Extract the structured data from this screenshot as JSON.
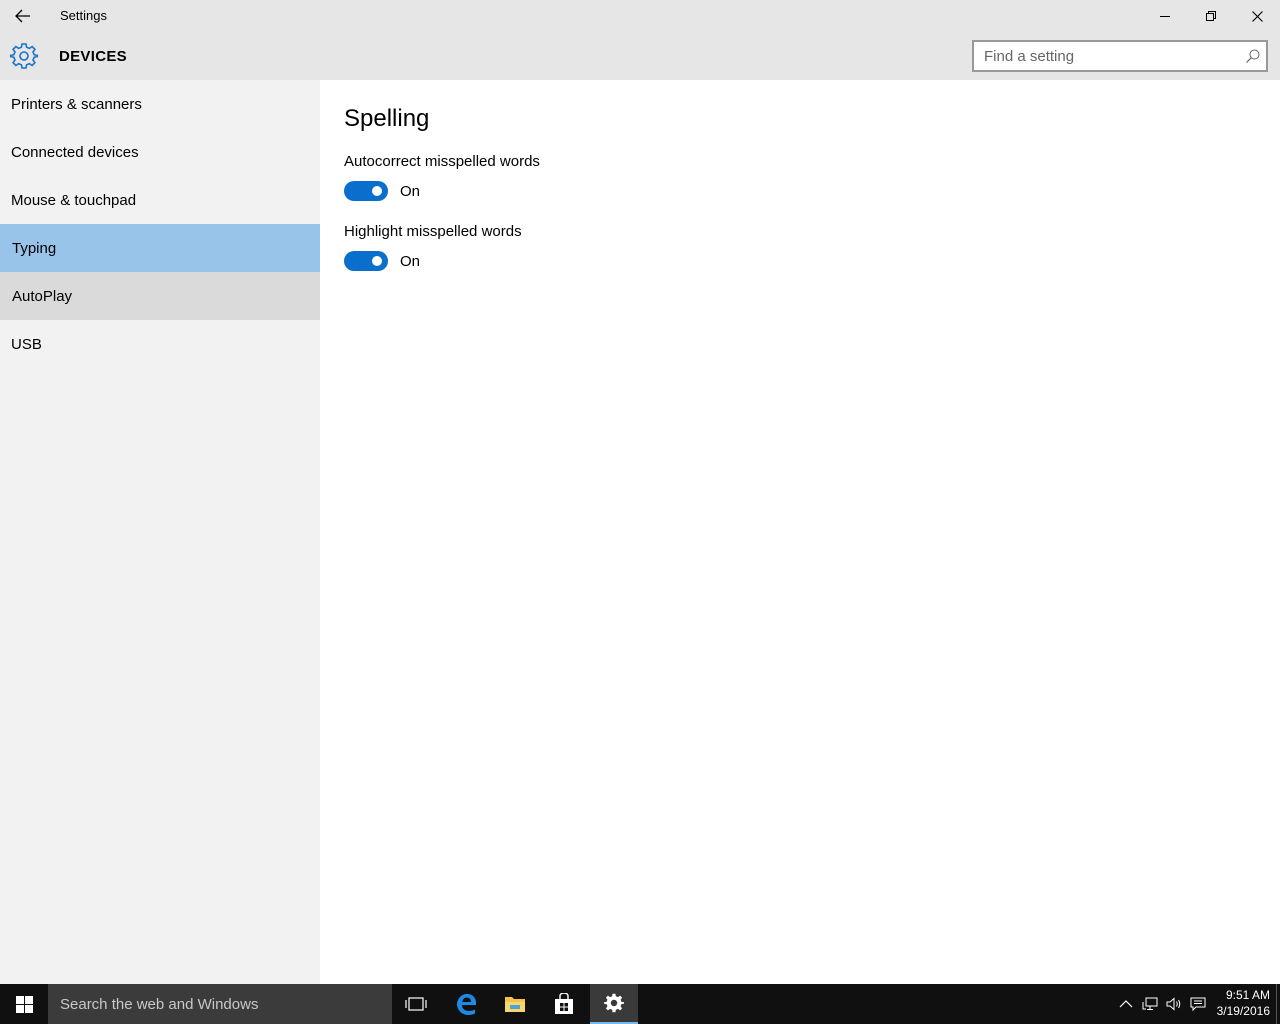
{
  "window": {
    "title": "Settings",
    "back_icon": "back-arrow-icon",
    "controls": [
      "minimize-icon",
      "restore-icon",
      "close-icon"
    ]
  },
  "header": {
    "icon": "gear-icon",
    "title": "DEVICES",
    "search_placeholder": "Find a setting",
    "search_icon": "search-icon"
  },
  "sidebar": {
    "items": [
      {
        "label": "Printers & scanners",
        "state": "normal"
      },
      {
        "label": "Connected devices",
        "state": "normal"
      },
      {
        "label": "Mouse & touchpad",
        "state": "normal"
      },
      {
        "label": "Typing",
        "state": "selected"
      },
      {
        "label": "AutoPlay",
        "state": "hover"
      },
      {
        "label": "USB",
        "state": "normal"
      }
    ]
  },
  "main": {
    "section_title": "Spelling",
    "settings": [
      {
        "label": "Autocorrect misspelled words",
        "state_label": "On",
        "on": true
      },
      {
        "label": "Highlight misspelled words",
        "state_label": "On",
        "on": true
      }
    ]
  },
  "taskbar": {
    "search_text": "Search the web and Windows",
    "apps": [
      "task-view-icon",
      "edge-icon",
      "file-explorer-icon",
      "store-icon",
      "settings-gear-icon"
    ],
    "active_app": "settings-gear-icon",
    "tray_icons": [
      "chevron-up-icon",
      "network-icon",
      "volume-icon",
      "action-center-icon"
    ],
    "time": "9:51 AM",
    "date": "3/19/2016"
  },
  "colors": {
    "accent": "#0a6fcc",
    "selected_nav": "#99c4ea",
    "hover_nav": "#dadada",
    "sidebar_bg": "#f2f2f2",
    "header_bg": "#e6e6e6",
    "taskbar_bg": "#101010"
  }
}
